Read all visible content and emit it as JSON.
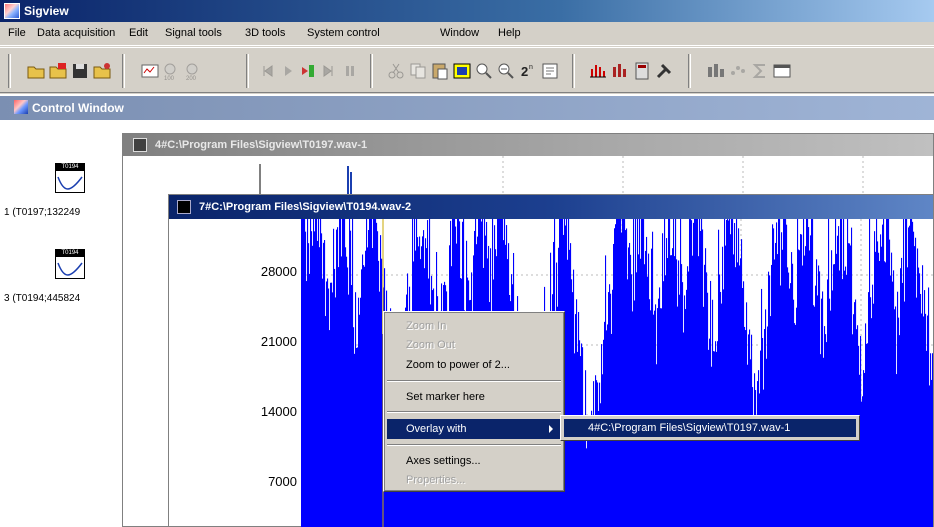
{
  "app": {
    "title": "Sigview"
  },
  "menubar": {
    "items": [
      {
        "label": "File"
      },
      {
        "label": "Data acquisition"
      },
      {
        "label": "Edit"
      },
      {
        "label": "Signal tools"
      },
      {
        "label": "3D tools"
      },
      {
        "label": "System control"
      },
      {
        "label": "Window"
      },
      {
        "label": "Help"
      }
    ]
  },
  "toolbar": {
    "icons": [
      "open-icon",
      "import-icon",
      "save-icon",
      "open-folder-icon",
      "stats-icon",
      "zoom-100-icon",
      "zoom-200-icon",
      "first-icon",
      "play-icon",
      "next-marker-icon",
      "next-icon",
      "pause-icon",
      "cut-icon",
      "copy-icon",
      "paste-icon",
      "select-icon",
      "zoom-in-icon",
      "zoom-out-icon",
      "zoom-power-icon",
      "properties-icon",
      "spectrum-icon",
      "filter-icon",
      "calc-icon",
      "tools-icon",
      "chart-icon",
      "scatter-icon",
      "sum-icon",
      "window-icon"
    ]
  },
  "control_window": {
    "title": "Control Window",
    "items": [
      {
        "thumb_label": "T0194",
        "label": "1 (T0197;132249"
      },
      {
        "thumb_label": "T0194",
        "label": "3 (T0194;445824"
      }
    ]
  },
  "windows": {
    "back": {
      "title": "4#C:\\Program Files\\Sigview\\T0197.wav-1"
    },
    "front": {
      "title": "7#C:\\Program Files\\Sigview\\T0194.wav-2"
    }
  },
  "chart_data": {
    "type": "bar",
    "series_color": "#0000ff",
    "y_ticks": [
      "28000",
      "21000",
      "14000",
      "7000"
    ],
    "grid": true
  },
  "context_menu": {
    "items": [
      {
        "label": "Zoom In",
        "disabled": true
      },
      {
        "label": "Zoom Out",
        "disabled": true
      },
      {
        "label": "Zoom to power of 2...",
        "disabled": false
      },
      {
        "label": "Set marker here",
        "disabled": false
      },
      {
        "label": "Overlay with",
        "disabled": false,
        "selected": true
      },
      {
        "label": "Axes settings...",
        "disabled": false
      },
      {
        "label": "Properties...",
        "disabled": true
      }
    ],
    "submenu": {
      "label": "4#C:\\Program Files\\Sigview\\T0197.wav-1"
    }
  }
}
